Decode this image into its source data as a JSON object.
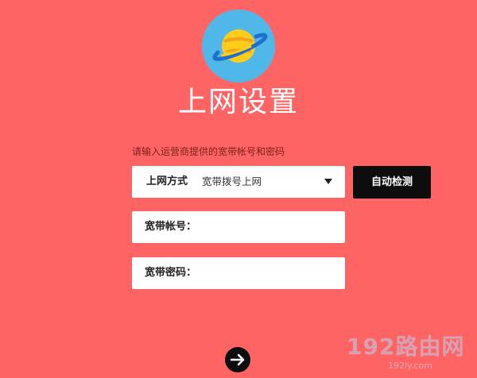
{
  "page": {
    "title": "上网设置",
    "hint": "请输入运营商提供的宽带帐号和密码",
    "logo_icon": "planet-icon"
  },
  "connection": {
    "label": "上网方式",
    "selected": "宽带拨号上网",
    "detect_button": "自动检测"
  },
  "account": {
    "label": "宽带帐号：",
    "value": ""
  },
  "password": {
    "label": "宽带密码：",
    "value": ""
  },
  "next": {
    "icon": "arrow-right-icon"
  },
  "watermark": {
    "main": "192路由网",
    "sub": "192ly.com"
  },
  "colors": {
    "background": "#ff6464",
    "button": "#0d0d0d",
    "logo_bg": "#4fb8e8",
    "planet": "#ffcc1a",
    "ring": "#1f6fd1"
  }
}
